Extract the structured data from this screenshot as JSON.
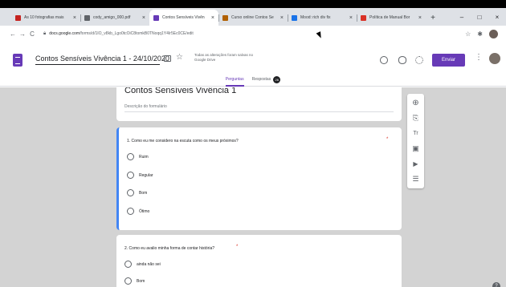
{
  "browser": {
    "tabs": [
      {
        "title": "As 10 fotografias mais",
        "color": "#c5221f",
        "active": false
      },
      {
        "title": "cody_amigo_000.pdf",
        "color": "#5f6368",
        "active": false
      },
      {
        "title": "Contos Sensíveis Vivên",
        "color": "#673ab7",
        "active": true
      },
      {
        "title": "Curso online Contos Se",
        "color": "#b06000",
        "active": false
      },
      {
        "title": "Mood: rich div fix",
        "color": "#1a73e8",
        "active": false
      },
      {
        "title": "Política de Manual Bor",
        "color": "#d93025",
        "active": false
      }
    ],
    "new_tab": "+",
    "controls": {
      "minimize": "–",
      "maximize": "□",
      "close": "×"
    },
    "nav": {
      "back": "←",
      "forward": "→",
      "reload": "C"
    },
    "url_host": "docs.google.com",
    "url_path": "/forms/d/1IO_v8kb_Lgo0tcOiC8tomkB0TNoqq1Y4Ir5Ec0CE/edit",
    "toolbar_icons": {
      "star": "☆",
      "extensions": "✱"
    }
  },
  "forms_header": {
    "doc_title": "Contos Sensíveis Vivência 1 - 24/10/2020",
    "save_status": "Todas as alterações foram salvas no Google Drive",
    "send_label": "Enviar",
    "more_icon": "⋮",
    "tabs": [
      {
        "label": "Perguntas",
        "active": true
      },
      {
        "label": "Respostas",
        "active": false
      }
    ],
    "responses_count": "26"
  },
  "form": {
    "title": "Contos Sensíveis Vivência 1",
    "description_placeholder": "Descrição do formulário",
    "questions": [
      {
        "text": "1. Como eu me considero na escuta como os meus próximos?",
        "required_mark": "*",
        "options": [
          "Ruim",
          "Regular",
          "Bom",
          "Ótimo"
        ]
      },
      {
        "text": "2. Como eu avalio minha forma de contar história?",
        "required_mark": "*",
        "options": [
          "ainda não sei",
          "Bom"
        ]
      }
    ]
  },
  "side_toolbar": {
    "icons": [
      "⊕",
      "⎘",
      "Tr",
      "▣",
      "▶",
      "☰"
    ]
  },
  "help": "?",
  "colors": {
    "accent": "#673ab7",
    "canvas": "#d3d3d3",
    "active_question": "#4285f4",
    "required": "#d93025"
  }
}
